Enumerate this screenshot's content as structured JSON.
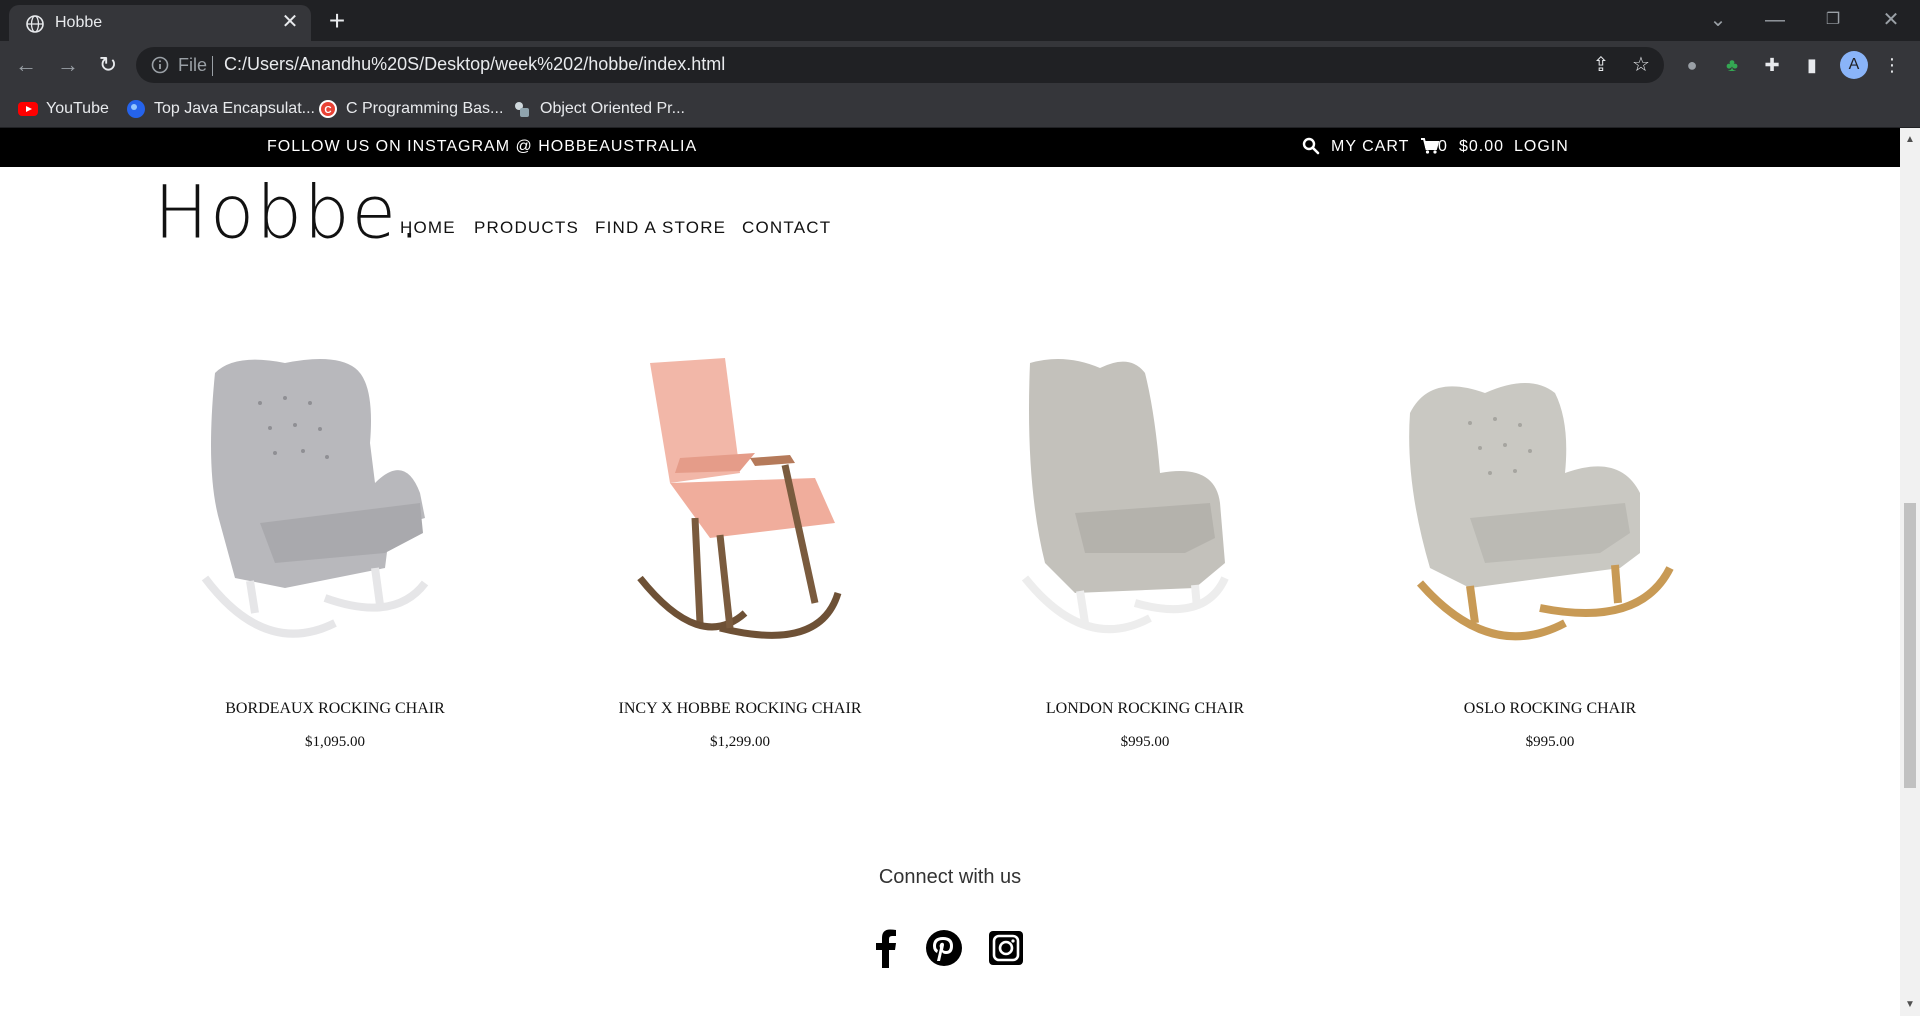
{
  "browser": {
    "tab_title": "Hobbe",
    "file_label": "File",
    "url": "C:/Users/Anandhu%20S/Desktop/week%202/hobbe/index.html",
    "avatar_letter": "A",
    "bookmarks": [
      {
        "label": "YouTube",
        "icon": "youtube-icon",
        "color": "#ff0000"
      },
      {
        "label": "Top Java Encapsulat...",
        "icon": "java-icon",
        "color": "#3b82f6"
      },
      {
        "label": "C Programming Bas...",
        "icon": "c-lang-icon",
        "color": "#e94235"
      },
      {
        "label": "Object Oriented Pr...",
        "icon": "oop-icon",
        "color": "#9aa0a6"
      }
    ]
  },
  "topbar": {
    "follow": "FOLLOW US ON INSTAGRAM @ HOBBEAUSTRALIA",
    "my_cart": "MY CART",
    "cart_count": "0",
    "cart_total": "$0.00",
    "login": "LOGIN"
  },
  "header": {
    "logo": "Hobbe.",
    "nav": [
      "HOME",
      "PRODUCTS",
      "FIND A STORE",
      "CONTACT"
    ]
  },
  "products": [
    {
      "name": "BORDEAUX ROCKING CHAIR",
      "price": "$1,095.00",
      "fabric": "#b9b9bd",
      "base": "#e9e9ea"
    },
    {
      "name": "INCY X HOBBE ROCKING CHAIR",
      "price": "$1,299.00",
      "fabric": "#f2b7a8",
      "base": "#7a5b3e"
    },
    {
      "name": "LONDON ROCKING CHAIR",
      "price": "$995.00",
      "fabric": "#c3c1bb",
      "base": "#eeeeee"
    },
    {
      "name": "OSLO ROCKING CHAIR",
      "price": "$995.00",
      "fabric": "#c9c8c2",
      "base": "#c89a55"
    }
  ],
  "footer": {
    "connect": "Connect with us",
    "social": [
      "facebook-icon",
      "pinterest-icon",
      "instagram-icon"
    ]
  }
}
